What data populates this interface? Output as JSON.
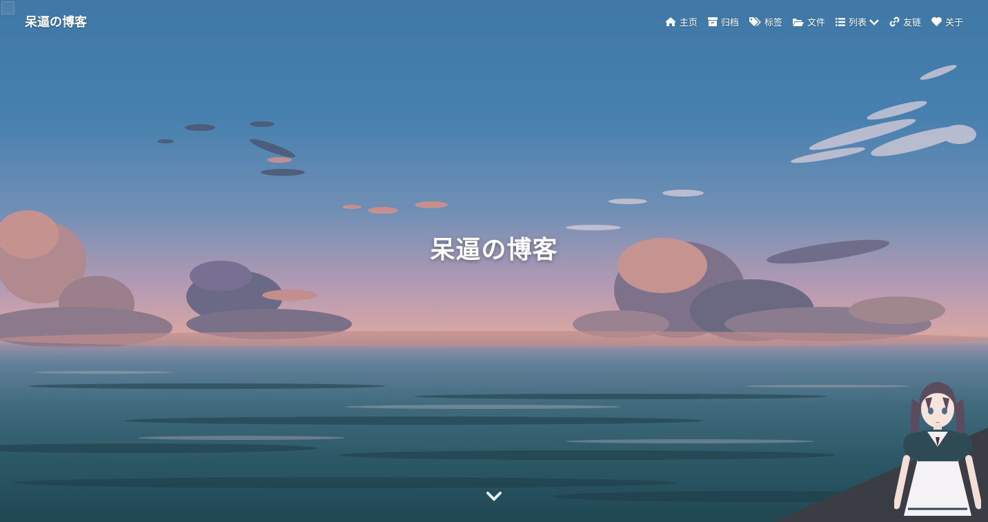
{
  "header": {
    "logo": "呆逼の博客"
  },
  "nav": {
    "items": [
      {
        "label": "主页",
        "icon": "home-icon"
      },
      {
        "label": "归档",
        "icon": "archive-icon"
      },
      {
        "label": "标签",
        "icon": "tags-icon"
      },
      {
        "label": "文件",
        "icon": "folder-open-icon"
      },
      {
        "label": "列表",
        "icon": "list-icon"
      },
      {
        "label": "友链",
        "icon": "link-icon"
      },
      {
        "label": "关于",
        "icon": "heart-icon"
      }
    ]
  },
  "hero": {
    "title": "呆逼の博客"
  },
  "colors": {
    "sky_top": "#3f78a6",
    "sky_horizon": "#d8a7a3",
    "sea": "#2c5866",
    "text": "#ffffff"
  }
}
